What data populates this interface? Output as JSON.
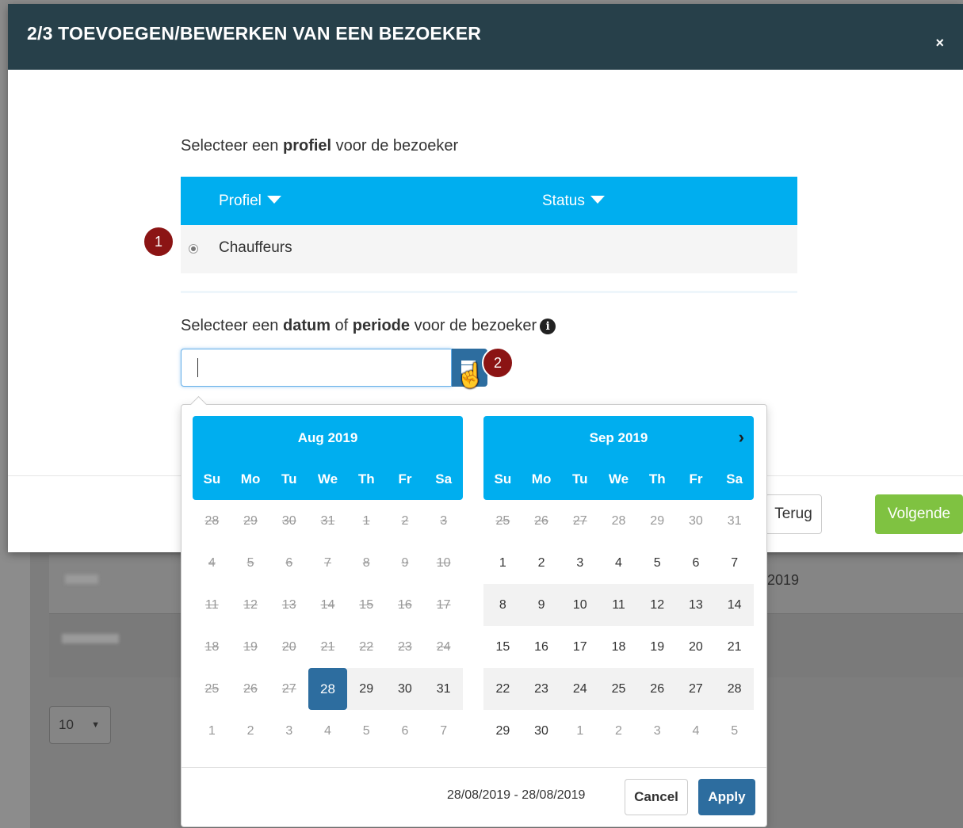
{
  "modal": {
    "title": "2/3 TOEVOEGEN/BEWERKEN VAN EEN BEZOEKER",
    "close_label": "×"
  },
  "profile_section": {
    "label_prefix": "Selecteer een ",
    "label_bold": "profiel",
    "label_suffix": " voor de bezoeker"
  },
  "table": {
    "headers": [
      "Profiel",
      "Status"
    ],
    "rows": [
      {
        "profiel": "Chauffeurs",
        "selected": true
      }
    ]
  },
  "markers": [
    "1",
    "2"
  ],
  "date_section": {
    "label_prefix": "Selecteer een ",
    "label_bold1": "datum",
    "label_mid": " of ",
    "label_bold2": "periode",
    "label_suffix": " voor de bezoeker",
    "info_icon": "i"
  },
  "date_input": {
    "value": ""
  },
  "calendars": [
    {
      "month": "Aug 2019",
      "weekdays": [
        "Su",
        "Mo",
        "Tu",
        "We",
        "Th",
        "Fr",
        "Sa"
      ],
      "weeks": [
        [
          {
            "d": "28",
            "s": "off"
          },
          {
            "d": "29",
            "s": "off"
          },
          {
            "d": "30",
            "s": "off"
          },
          {
            "d": "31",
            "s": "off"
          },
          {
            "d": "1",
            "s": "off"
          },
          {
            "d": "2",
            "s": "off"
          },
          {
            "d": "3",
            "s": "off"
          }
        ],
        [
          {
            "d": "4",
            "s": "off"
          },
          {
            "d": "5",
            "s": "off"
          },
          {
            "d": "6",
            "s": "off"
          },
          {
            "d": "7",
            "s": "off"
          },
          {
            "d": "8",
            "s": "off"
          },
          {
            "d": "9",
            "s": "off"
          },
          {
            "d": "10",
            "s": "off"
          }
        ],
        [
          {
            "d": "11",
            "s": "off"
          },
          {
            "d": "12",
            "s": "off"
          },
          {
            "d": "13",
            "s": "off"
          },
          {
            "d": "14",
            "s": "off"
          },
          {
            "d": "15",
            "s": "off"
          },
          {
            "d": "16",
            "s": "off"
          },
          {
            "d": "17",
            "s": "off"
          }
        ],
        [
          {
            "d": "18",
            "s": "off"
          },
          {
            "d": "19",
            "s": "off"
          },
          {
            "d": "20",
            "s": "off"
          },
          {
            "d": "21",
            "s": "off"
          },
          {
            "d": "22",
            "s": "off"
          },
          {
            "d": "23",
            "s": "off"
          },
          {
            "d": "24",
            "s": "off"
          }
        ],
        [
          {
            "d": "25",
            "s": "off"
          },
          {
            "d": "26",
            "s": "off"
          },
          {
            "d": "27",
            "s": "off"
          },
          {
            "d": "28",
            "s": "selected"
          },
          {
            "d": "29",
            "s": "inrange"
          },
          {
            "d": "30",
            "s": "inrange"
          },
          {
            "d": "31",
            "s": "inrange"
          }
        ],
        [
          {
            "d": "1",
            "s": "other"
          },
          {
            "d": "2",
            "s": "other"
          },
          {
            "d": "3",
            "s": "other"
          },
          {
            "d": "4",
            "s": "other"
          },
          {
            "d": "5",
            "s": "other"
          },
          {
            "d": "6",
            "s": "other"
          },
          {
            "d": "7",
            "s": "other"
          }
        ]
      ]
    },
    {
      "month": "Sep 2019",
      "next_arrow": "›",
      "weekdays": [
        "Su",
        "Mo",
        "Tu",
        "We",
        "Th",
        "Fr",
        "Sa"
      ],
      "weeks": [
        [
          {
            "d": "25",
            "s": "off"
          },
          {
            "d": "26",
            "s": "off"
          },
          {
            "d": "27",
            "s": "off"
          },
          {
            "d": "28",
            "s": "other"
          },
          {
            "d": "29",
            "s": "other"
          },
          {
            "d": "30",
            "s": "other"
          },
          {
            "d": "31",
            "s": "other"
          }
        ],
        [
          {
            "d": "1",
            "s": ""
          },
          {
            "d": "2",
            "s": ""
          },
          {
            "d": "3",
            "s": ""
          },
          {
            "d": "4",
            "s": ""
          },
          {
            "d": "5",
            "s": ""
          },
          {
            "d": "6",
            "s": ""
          },
          {
            "d": "7",
            "s": ""
          }
        ],
        [
          {
            "d": "8",
            "s": "inrange"
          },
          {
            "d": "9",
            "s": "inrange"
          },
          {
            "d": "10",
            "s": "inrange"
          },
          {
            "d": "11",
            "s": "inrange"
          },
          {
            "d": "12",
            "s": "inrange"
          },
          {
            "d": "13",
            "s": "inrange"
          },
          {
            "d": "14",
            "s": "inrange"
          }
        ],
        [
          {
            "d": "15",
            "s": ""
          },
          {
            "d": "16",
            "s": ""
          },
          {
            "d": "17",
            "s": ""
          },
          {
            "d": "18",
            "s": ""
          },
          {
            "d": "19",
            "s": ""
          },
          {
            "d": "20",
            "s": ""
          },
          {
            "d": "21",
            "s": ""
          }
        ],
        [
          {
            "d": "22",
            "s": "inrange"
          },
          {
            "d": "23",
            "s": "inrange"
          },
          {
            "d": "24",
            "s": "inrange"
          },
          {
            "d": "25",
            "s": "inrange"
          },
          {
            "d": "26",
            "s": "inrange"
          },
          {
            "d": "27",
            "s": "inrange"
          },
          {
            "d": "28",
            "s": "inrange"
          }
        ],
        [
          {
            "d": "29",
            "s": ""
          },
          {
            "d": "30",
            "s": ""
          },
          {
            "d": "1",
            "s": "other"
          },
          {
            "d": "2",
            "s": "other"
          },
          {
            "d": "3",
            "s": "other"
          },
          {
            "d": "4",
            "s": "other"
          },
          {
            "d": "5",
            "s": "other"
          }
        ]
      ]
    }
  ],
  "picker_footer": {
    "range_text": "28/08/2019 - 28/08/2019",
    "cancel_label": "Cancel",
    "apply_label": "Apply"
  },
  "modal_footer": {
    "back_label": "Terug",
    "next_label": "Volgende"
  },
  "background": {
    "year_fragment": "2019",
    "page_size_value": "10"
  },
  "colors": {
    "header_bg": "#27404a",
    "accent_blue": "#00aeef",
    "selected_blue": "#2d6d9f",
    "marker_red": "#8b1414",
    "next_green": "#7fc241"
  },
  "icons": [
    "close-icon",
    "caret-down-icon",
    "info-icon",
    "calendar-icon",
    "hand-pointer-icon",
    "chevron-right-icon",
    "radio-icon"
  ]
}
